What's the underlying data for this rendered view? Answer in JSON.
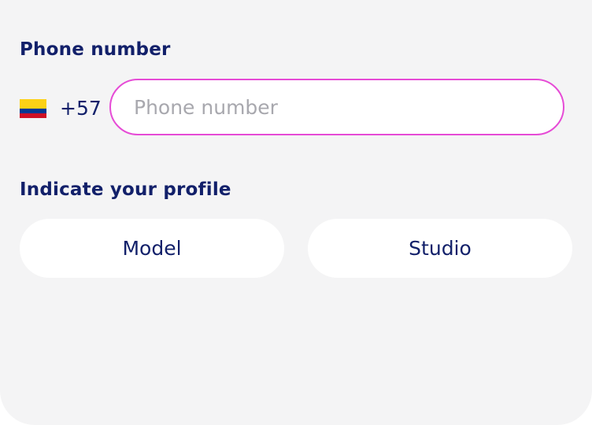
{
  "phone": {
    "label": "Phone number",
    "country_flag": "colombia-flag",
    "country_code": "+57",
    "input_value": "",
    "input_placeholder": "Phone number"
  },
  "profile": {
    "label": "Indicate your profile",
    "options": [
      "Model",
      "Studio"
    ]
  },
  "colors": {
    "primary_text": "#12206a",
    "input_focus_border": "#e64bd6",
    "background": "#f4f4f5",
    "flag_yellow": "#FCD116",
    "flag_blue": "#003893",
    "flag_red": "#CE1126"
  }
}
